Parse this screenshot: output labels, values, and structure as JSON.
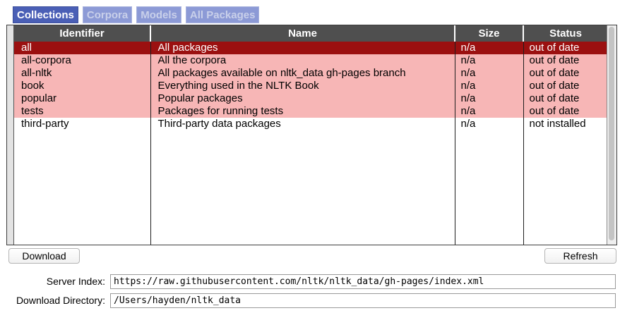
{
  "tabs": [
    {
      "label": "Collections",
      "active": true
    },
    {
      "label": "Corpora",
      "active": false
    },
    {
      "label": "Models",
      "active": false
    },
    {
      "label": "All Packages",
      "active": false
    }
  ],
  "table": {
    "columns": [
      "Identifier",
      "Name",
      "Size",
      "Status"
    ],
    "rows": [
      {
        "id": "all",
        "name": "All packages",
        "size": "n/a",
        "status": "out of date",
        "state": "selected"
      },
      {
        "id": "all-corpora",
        "name": "All the corpora",
        "size": "n/a",
        "status": "out of date",
        "state": "outdated"
      },
      {
        "id": "all-nltk",
        "name": "All packages available on nltk_data gh-pages branch",
        "size": "n/a",
        "status": "out of date",
        "state": "outdated"
      },
      {
        "id": "book",
        "name": "Everything used in the NLTK Book",
        "size": "n/a",
        "status": "out of date",
        "state": "outdated"
      },
      {
        "id": "popular",
        "name": "Popular packages",
        "size": "n/a",
        "status": "out of date",
        "state": "outdated"
      },
      {
        "id": "tests",
        "name": "Packages for running tests",
        "size": "n/a",
        "status": "out of date",
        "state": "outdated"
      },
      {
        "id": "third-party",
        "name": "Third-party data packages",
        "size": "n/a",
        "status": "not installed",
        "state": "plain"
      }
    ]
  },
  "buttons": {
    "download": "Download",
    "refresh": "Refresh"
  },
  "server_index": {
    "label": "Server Index:",
    "value": "https://raw.githubusercontent.com/nltk/nltk_data/gh-pages/index.xml"
  },
  "download_directory": {
    "label": "Download Directory:",
    "value": "/Users/hayden/nltk_data"
  },
  "colors": {
    "selected_row": "#9b1010",
    "outdated_row": "#f7b6b6",
    "header_bg": "#4f4f4f",
    "active_tab": "#4a5fb6",
    "inactive_tab": "#8c9ad6"
  }
}
